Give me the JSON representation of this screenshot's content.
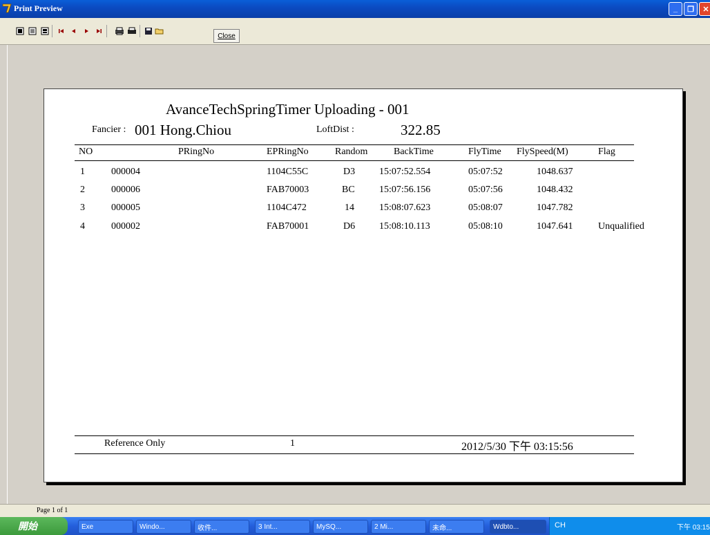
{
  "window": {
    "title": "Print Preview",
    "minimize_glyph": "_",
    "maximize_glyph": "❐",
    "close_glyph": "✕"
  },
  "toolbar": {
    "close_label": "Close",
    "icons": [
      "one-page-icon",
      "two-pages-icon",
      "zoom-icon",
      "first-page-icon",
      "prev-page-icon",
      "next-page-icon",
      "last-page-icon",
      "print-setup-icon",
      "print-icon",
      "save-icon",
      "open-icon"
    ]
  },
  "report": {
    "title": "AvanceTechSpringTimer Uploading - 001",
    "fancier_label": "Fancier :",
    "fancier_value": "001 Hong.Chiou",
    "loftdist_label": "LoftDist :",
    "loftdist_value": "322.85",
    "columns": {
      "no": "NO",
      "pring": "PRingNo",
      "epring": "EPRingNo",
      "random": "Random",
      "backtime": "BackTime",
      "flytime": "FlyTime",
      "flyspeed": "FlySpeed(M)",
      "flag": "Flag"
    },
    "rows": [
      {
        "no": "1",
        "pring": "000004",
        "epring": "1104C55C",
        "random": "D3",
        "backtime": "15:07:52.554",
        "flytime": "05:07:52",
        "flyspeed": "1048.637",
        "flag": ""
      },
      {
        "no": "2",
        "pring": "000006",
        "epring": "FAB70003",
        "random": "BC",
        "backtime": "15:07:56.156",
        "flytime": "05:07:56",
        "flyspeed": "1048.432",
        "flag": ""
      },
      {
        "no": "3",
        "pring": "000005",
        "epring": "1104C472",
        "random": "14",
        "backtime": "15:08:07.623",
        "flytime": "05:08:07",
        "flyspeed": "1047.782",
        "flag": ""
      },
      {
        "no": "4",
        "pring": "000002",
        "epring": "FAB70001",
        "random": "D6",
        "backtime": "15:08:10.113",
        "flytime": "05:08:10",
        "flyspeed": "1047.641",
        "flag": "Unqualified"
      }
    ],
    "footer": {
      "reference": "Reference Only",
      "page": "1",
      "datetime": "2012/5/30 下午 03:15:56"
    }
  },
  "status": {
    "page_indicator": "Page 1 of 1"
  },
  "taskbar": {
    "start_label": "開始",
    "tasks": [
      "Exe",
      "Windo...",
      "收件...",
      "3 Int...",
      "MySQ...",
      "2 Mi...",
      "未命...",
      "Wdbto..."
    ],
    "ime": "CH",
    "time": "下午 03:15"
  }
}
